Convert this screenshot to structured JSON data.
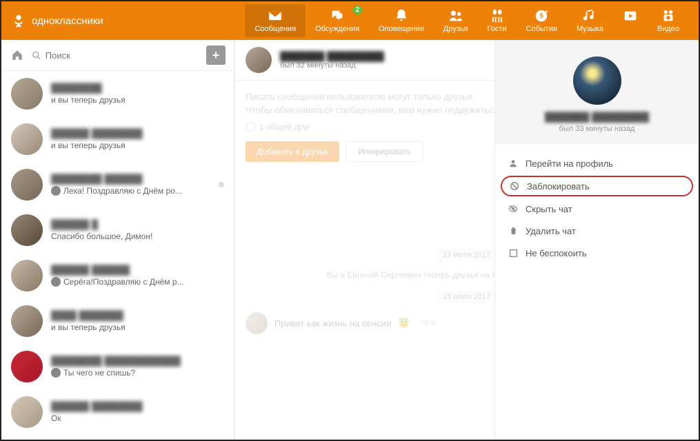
{
  "brand": "одноклассники",
  "nav": {
    "messages": "Сообщения",
    "discussions": "Обсуждения",
    "discussions_badge": "2",
    "notifications": "Оповещения",
    "friends": "Друзья",
    "guests": "Гости",
    "events": "События",
    "music": "Музыка",
    "video": "Видео"
  },
  "search": {
    "placeholder": "Поиск"
  },
  "chats": [
    {
      "name": "████████",
      "preview": "и вы теперь друзья"
    },
    {
      "name": "██████ ████████",
      "preview": "и вы теперь друзья"
    },
    {
      "name": "████████ ██████",
      "preview": "Леха! Поздравляю с Днём ро...",
      "mini": true,
      "unread": true
    },
    {
      "name": "██████ █",
      "preview": "Спасибо большое, Димон!"
    },
    {
      "name": "██████ ██████",
      "preview": "Серёга!Поздравляю с Днём р...",
      "mini": true
    },
    {
      "name": "████ ███████",
      "preview": "и вы теперь друзья"
    },
    {
      "name": "████████ ████████████",
      "preview": "Ты чего не спишь?",
      "mini": true
    },
    {
      "name": "██████ ████████",
      "preview": "Ок"
    }
  ],
  "conversation": {
    "name": "███████ █████████",
    "status": "был 32 минуты назад",
    "notice1": "Писать сообщения пользователю могут только друзья.",
    "notice2": "Чтобы обмениваться сообщениями, вам нужно подружиться",
    "mutual": "1 общий друг",
    "add_btn": "Добавить в друзья",
    "ignore_btn": "Игнорировать",
    "date1": "13 июля 2017",
    "sys_msg": "Вы и      Евгений Сергеевич теперь друзья на Одноклассниках нового друга",
    "date2": "15 июля 2017",
    "msg1": "Привет как жизнь на пенсии",
    "msg1_time": "19:47"
  },
  "panel": {
    "name": "███████ █████████",
    "status": "был 33 минуты назад",
    "menu": {
      "profile": "Перейти на профиль",
      "block": "Заблокировать",
      "hide": "Скрыть чат",
      "delete": "Удалить чат",
      "dnd": "Не беспокоить"
    }
  }
}
